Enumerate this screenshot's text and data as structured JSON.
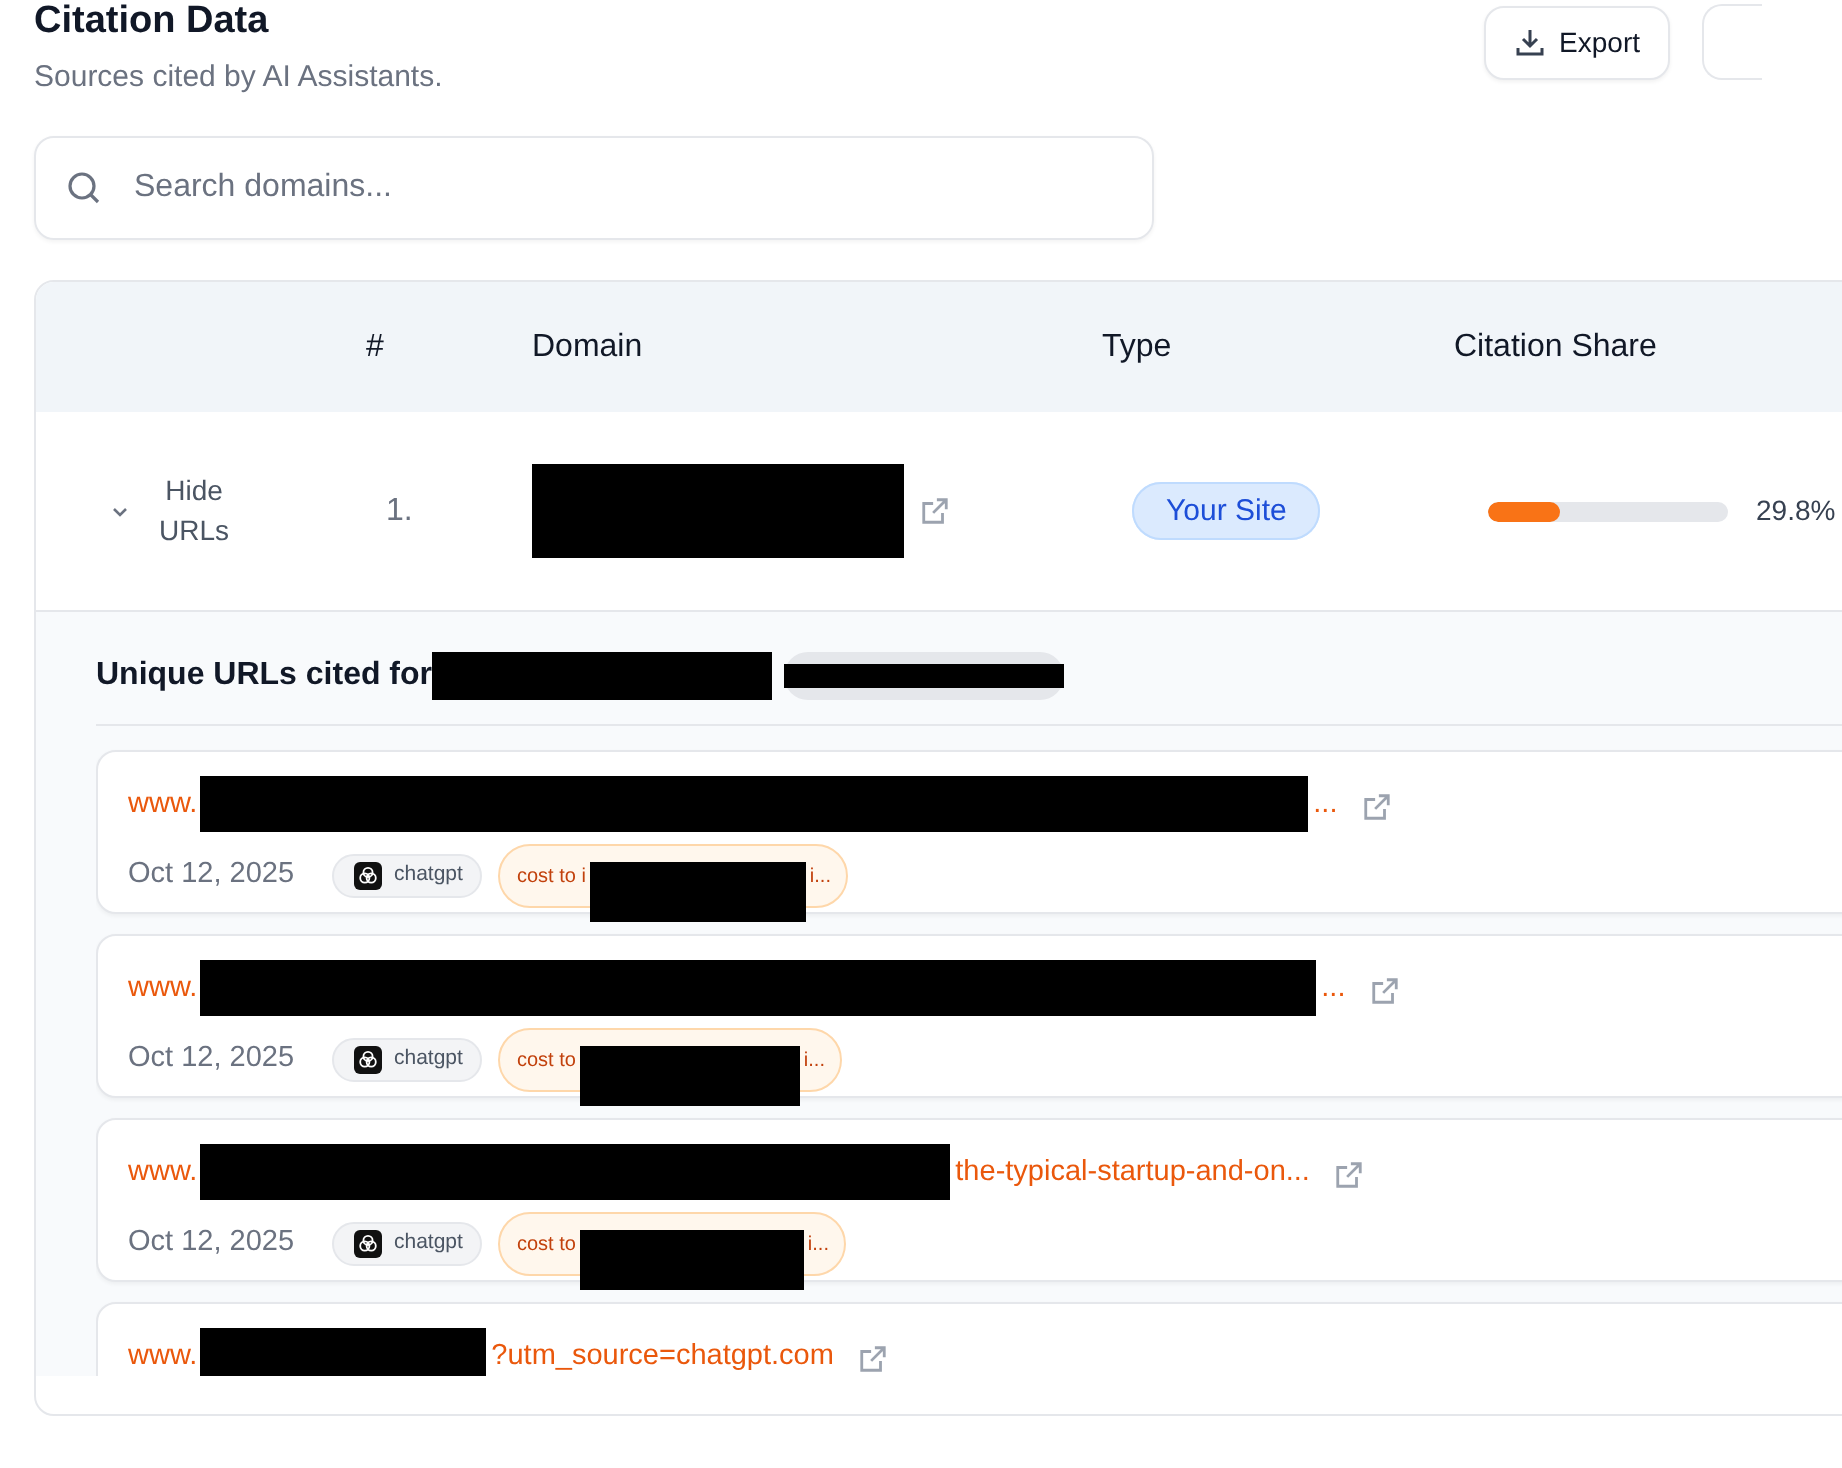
{
  "page": {
    "title": "Citation Data",
    "subtitle": "Sources cited by AI Assistants."
  },
  "toolbar": {
    "buttons": [
      "Export"
    ]
  },
  "search": {
    "placeholder": "Search domains..."
  },
  "table": {
    "columns": [
      "#",
      "Domain",
      "Type",
      "Citation Share"
    ],
    "rows": [
      {
        "toggle": "Hide URLs",
        "expanded": true,
        "rank": "1.",
        "type": "Your Site",
        "level": 0.3,
        "share": "29.8%"
      }
    ]
  },
  "urls_panel": {
    "heading": "Unique URLs cited for",
    "items": [
      {
        "prefix": "www.",
        "suffix": "...",
        "date": "Oct 12, 2025",
        "assistant": "chatgpt",
        "tag_prefix": "cost to i",
        "tag_suffix": "i..."
      },
      {
        "prefix": "www.",
        "suffix": "...",
        "date": "Oct 12, 2025",
        "assistant": "chatgpt",
        "tag_prefix": "cost to",
        "tag_suffix": "i..."
      },
      {
        "prefix": "www.",
        "suffix": "the-typical-startup-and-on...",
        "date": "Oct 12, 2025",
        "assistant": "chatgpt",
        "tag_prefix": "cost to",
        "tag_suffix": "i..."
      },
      {
        "prefix": "www.",
        "suffix": "?utm_source=chatgpt.com"
      }
    ]
  }
}
